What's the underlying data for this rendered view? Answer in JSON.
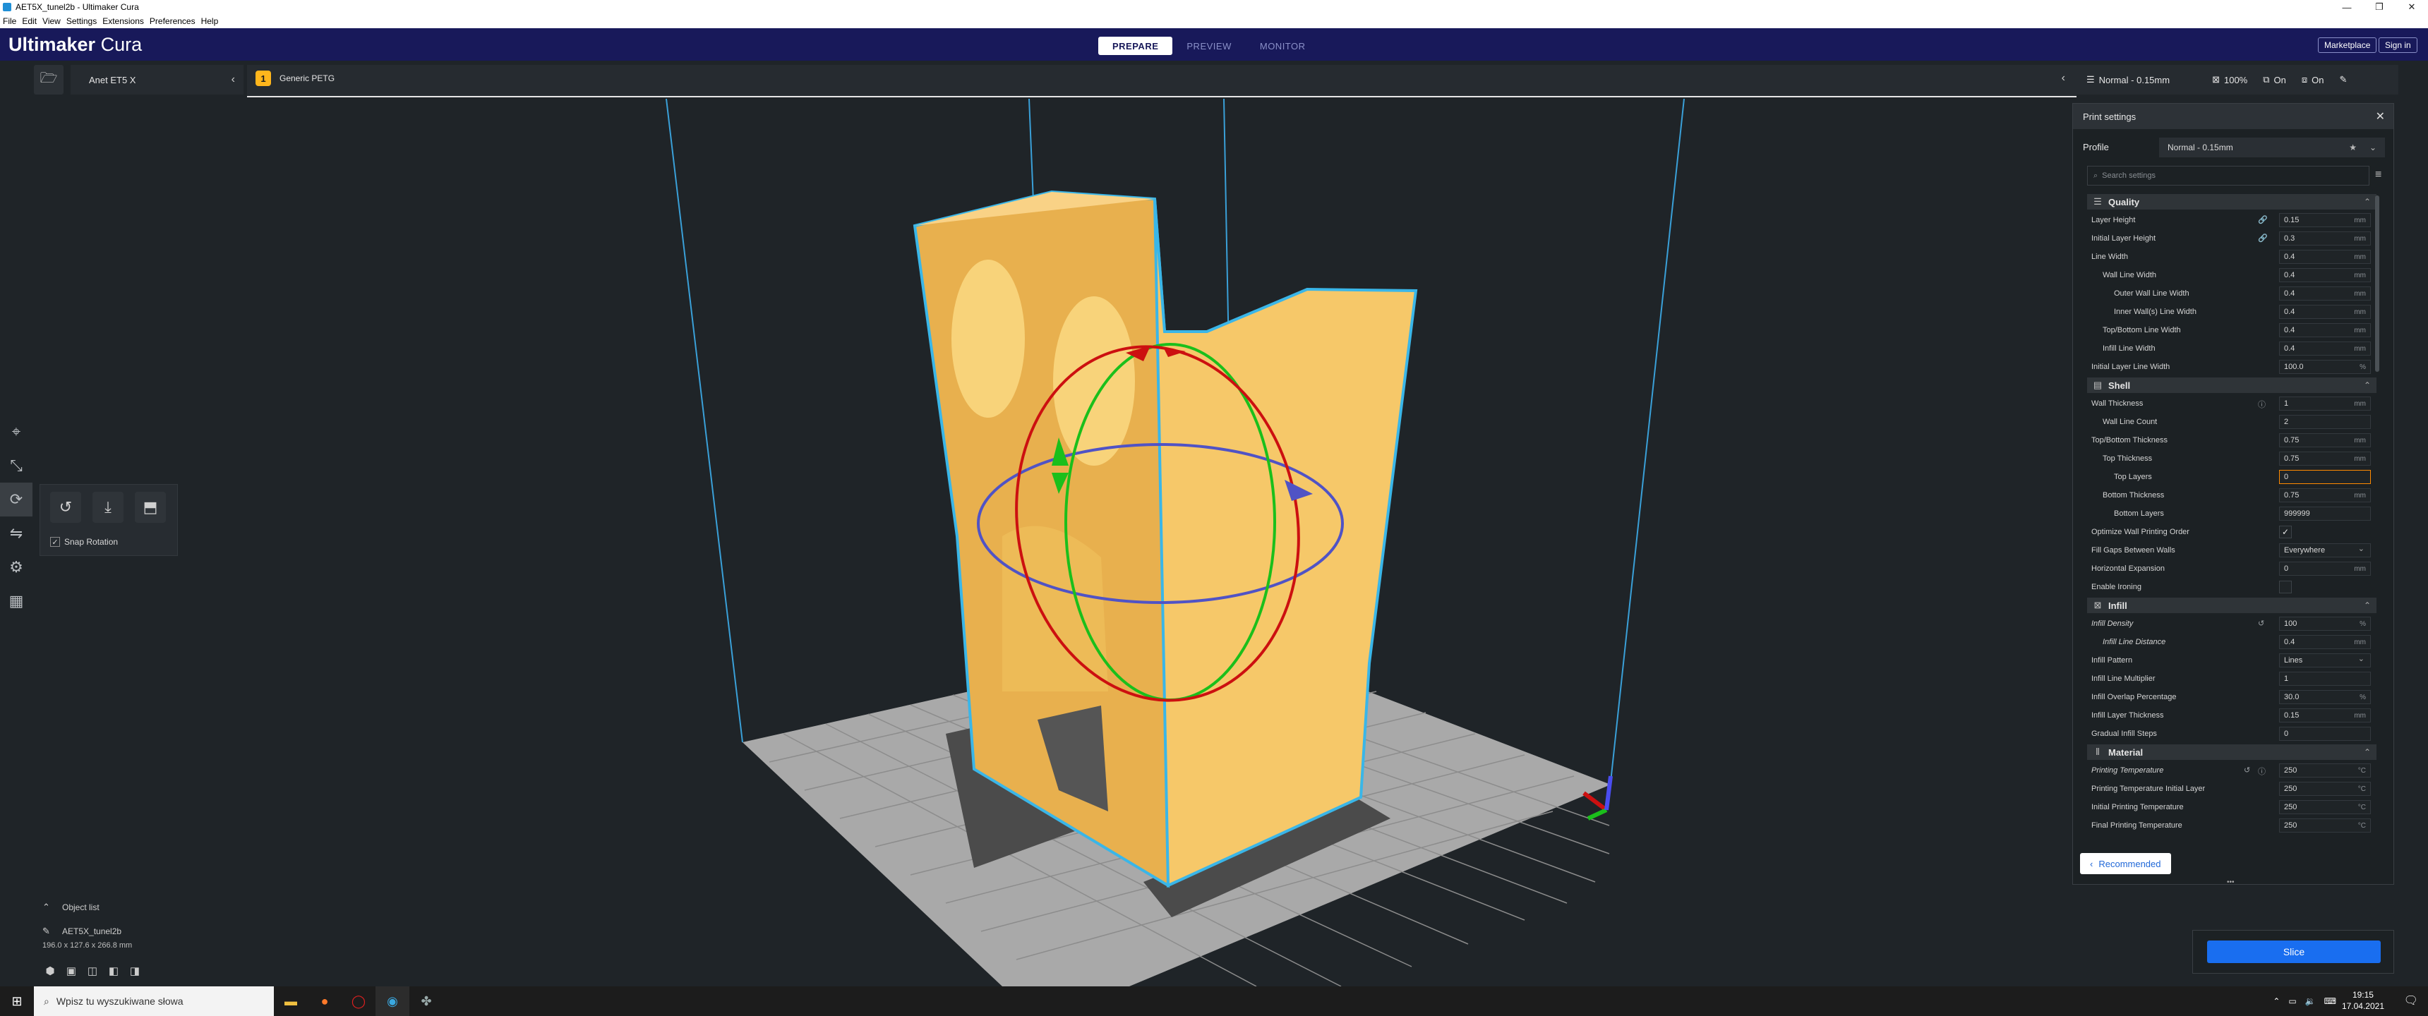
{
  "window": {
    "title": "AET5X_tunel2b - Ultimaker Cura",
    "controls": [
      "—",
      "❐",
      "✕"
    ]
  },
  "menu": [
    "File",
    "Edit",
    "View",
    "Settings",
    "Extensions",
    "Preferences",
    "Help"
  ],
  "header": {
    "logo_bold": "Ultimaker",
    "logo_light": " Cura",
    "tabs": [
      "PREPARE",
      "PREVIEW",
      "MONITOR"
    ],
    "active_tab": "PREPARE",
    "marketplace": "Marketplace",
    "signin": "Sign in"
  },
  "jobbar": {
    "printer": "Anet ET5 X",
    "material": "Generic PETG",
    "extruder_icon": "1",
    "profile": "Normal - 0.15mm",
    "support_value": "100%",
    "adhesion1": "On",
    "adhesion2": "On"
  },
  "rotate_panel": {
    "snap_label": "Snap Rotation",
    "snap_checked": true
  },
  "object_list": {
    "toggle": "Object list",
    "name": "AET5X_tunel2b",
    "dims": "196.0 x 127.6 x 266.8 mm"
  },
  "print_settings": {
    "title": "Print settings",
    "profile_label": "Profile",
    "profile_value": "Normal - 0.15mm",
    "search_placeholder": "Search settings",
    "recommended": "Recommended",
    "categories": {
      "quality": "Quality",
      "shell": "Shell",
      "infill": "Infill",
      "material": "Material"
    },
    "rows": {
      "layer_height": {
        "label": "Layer Height",
        "value": "0.15",
        "unit": "mm"
      },
      "initial_layer_height": {
        "label": "Initial Layer Height",
        "value": "0.3",
        "unit": "mm"
      },
      "line_width": {
        "label": "Line Width",
        "value": "0.4",
        "unit": "mm"
      },
      "wall_line_width": {
        "label": "Wall Line Width",
        "value": "0.4",
        "unit": "mm"
      },
      "outer_wall_line_width": {
        "label": "Outer Wall Line Width",
        "value": "0.4",
        "unit": "mm"
      },
      "inner_wall_line_width": {
        "label": "Inner Wall(s) Line Width",
        "value": "0.4",
        "unit": "mm"
      },
      "topbottom_line_width": {
        "label": "Top/Bottom Line Width",
        "value": "0.4",
        "unit": "mm"
      },
      "infill_line_width": {
        "label": "Infill Line Width",
        "value": "0.4",
        "unit": "mm"
      },
      "initial_layer_line_width": {
        "label": "Initial Layer Line Width",
        "value": "100.0",
        "unit": "%"
      },
      "wall_thickness": {
        "label": "Wall Thickness",
        "value": "1",
        "unit": "mm"
      },
      "wall_line_count": {
        "label": "Wall Line Count",
        "value": "2",
        "unit": ""
      },
      "topbottom_thickness": {
        "label": "Top/Bottom Thickness",
        "value": "0.75",
        "unit": "mm"
      },
      "top_thickness": {
        "label": "Top Thickness",
        "value": "0.75",
        "unit": "mm"
      },
      "top_layers": {
        "label": "Top Layers",
        "value": "0",
        "unit": ""
      },
      "bottom_thickness": {
        "label": "Bottom Thickness",
        "value": "0.75",
        "unit": "mm"
      },
      "bottom_layers": {
        "label": "Bottom Layers",
        "value": "999999",
        "unit": ""
      },
      "optimize_wall_order": {
        "label": "Optimize Wall Printing Order",
        "checked": "✓"
      },
      "fill_gaps": {
        "label": "Fill Gaps Between Walls",
        "value": "Everywhere"
      },
      "horizontal_expansion": {
        "label": "Horizontal Expansion",
        "value": "0",
        "unit": "mm"
      },
      "enable_ironing": {
        "label": "Enable Ironing",
        "checked": ""
      },
      "infill_density": {
        "label": "Infill Density",
        "value": "100",
        "unit": "%"
      },
      "infill_line_distance": {
        "label": "Infill Line Distance",
        "value": "0.4",
        "unit": "mm"
      },
      "infill_pattern": {
        "label": "Infill Pattern",
        "value": "Lines"
      },
      "infill_line_multiplier": {
        "label": "Infill Line Multiplier",
        "value": "1",
        "unit": ""
      },
      "infill_overlap": {
        "label": "Infill Overlap Percentage",
        "value": "30.0",
        "unit": "%"
      },
      "infill_layer_thickness": {
        "label": "Infill Layer Thickness",
        "value": "0.15",
        "unit": "mm"
      },
      "gradual_infill": {
        "label": "Gradual Infill Steps",
        "value": "0",
        "unit": ""
      },
      "printing_temp": {
        "label": "Printing Temperature",
        "value": "250",
        "unit": "°C"
      },
      "printing_temp_initial": {
        "label": "Printing Temperature Initial Layer",
        "value": "250",
        "unit": "°C"
      },
      "initial_printing_temp": {
        "label": "Initial Printing Temperature",
        "value": "250",
        "unit": "°C"
      },
      "final_printing_temp": {
        "label": "Final Printing Temperature",
        "value": "250",
        "unit": "°C"
      }
    }
  },
  "slice_label": "Slice",
  "taskbar": {
    "search_placeholder": "Wpisz tu wyszukiwane słowa",
    "time": "19:15",
    "date": "17.04.2021"
  },
  "colors": {
    "header": "#18195a",
    "accent": "#196ef0",
    "model": "#f5c468",
    "warning": "#ff8a00"
  }
}
